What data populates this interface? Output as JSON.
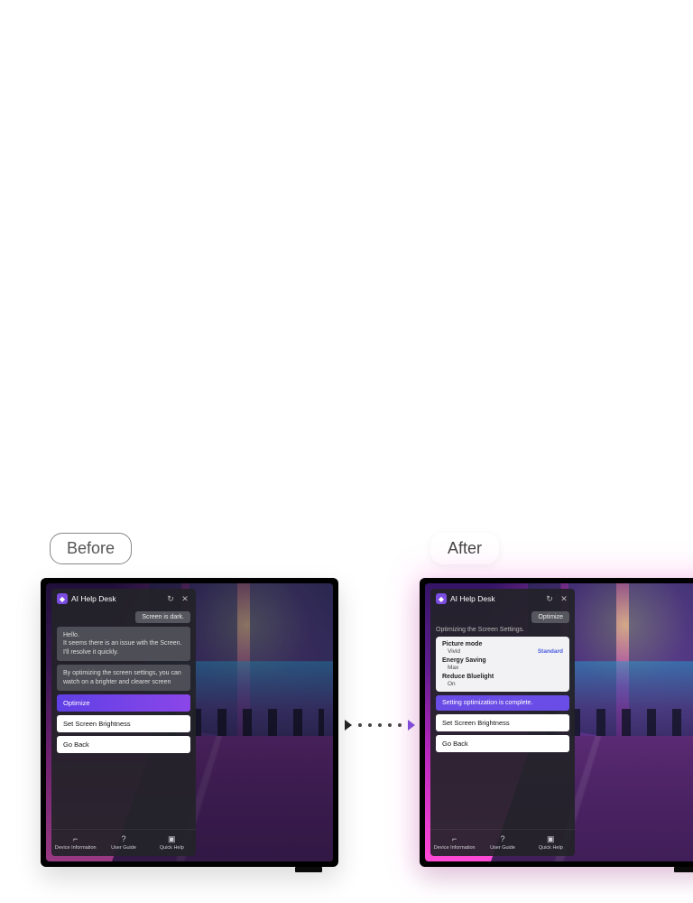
{
  "labels": {
    "before": "Before",
    "after": "After"
  },
  "panel": {
    "title": "AI Help Desk",
    "icons": {
      "app": "◆",
      "refresh": "↻",
      "close": "✕"
    },
    "footer": [
      {
        "icon": "⌐",
        "label": "Device Information"
      },
      {
        "icon": "?",
        "label": "User Guide"
      },
      {
        "icon": "▣",
        "label": "Quick Help"
      }
    ]
  },
  "before": {
    "user_chip": "Screen is dark.",
    "msg1": "Hello.\nIt seems there is an issue with the Screen.\nI'll resolve it quickly.",
    "msg2": "By optimizing the screen settings, you can watch on a brighter and clearer screen",
    "buttons": {
      "primary": "Optimize",
      "b2": "Set Screen Brightness",
      "b3": "Go Back"
    }
  },
  "after": {
    "user_chip": "Optimize",
    "section": "Optimizing the Screen Settings.",
    "settings": [
      {
        "k": "Picture mode",
        "v": "Vivid",
        "nv": "Standard"
      },
      {
        "k": "Energy Saving",
        "v": "Max",
        "nv": ""
      },
      {
        "k": "Reduce Bluelight",
        "v": "On",
        "nv": ""
      }
    ],
    "status": "Setting optimization is complete.",
    "buttons": {
      "b2": "Set Screen Brightness",
      "b3": "Go Back"
    }
  }
}
